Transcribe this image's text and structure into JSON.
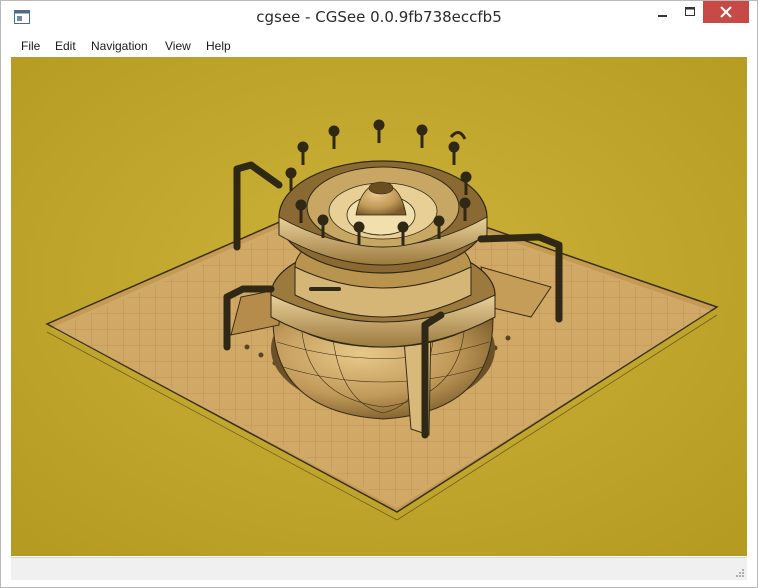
{
  "window": {
    "title": "cgsee - CGSee 0.0.9fb738eccfb5"
  },
  "menu": {
    "items": [
      "File",
      "Edit",
      "Navigation",
      "View",
      "Help"
    ]
  },
  "colors": {
    "viewport_background": "#c3a82a",
    "close_button": "#c84a47",
    "model_dark": "#2f2814"
  },
  "icons": {
    "app": "window-app-icon",
    "minimize": "minimize-icon",
    "maximize": "maximize-icon",
    "close": "close-icon",
    "resize": "resize-grip-icon"
  },
  "viewport": {
    "content": "3d-wireframe-model"
  }
}
